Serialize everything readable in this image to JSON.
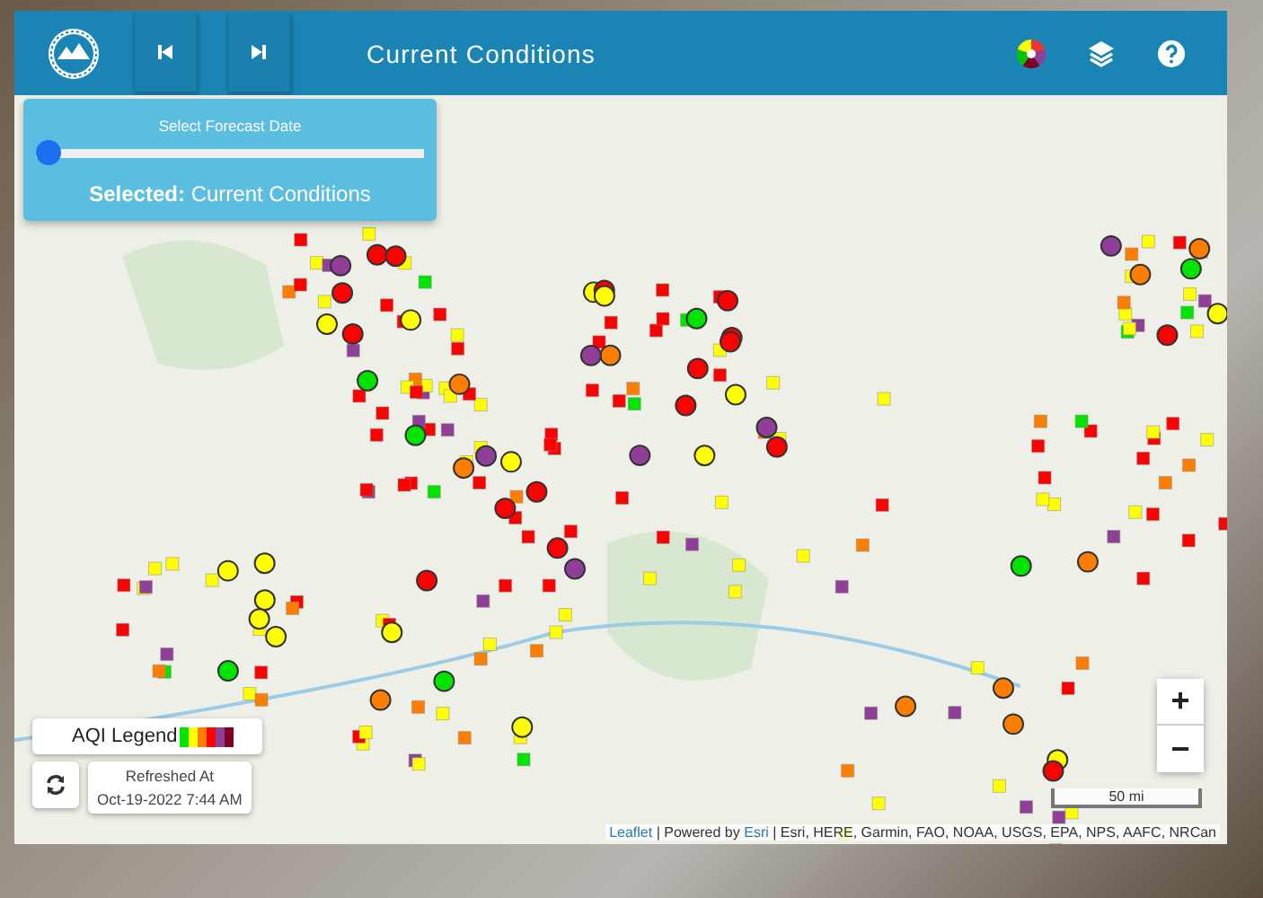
{
  "header": {
    "title": "Current Conditions"
  },
  "forecast_panel": {
    "title": "Select Forecast Date",
    "level": 0,
    "selected_label": "Selected:",
    "selected_value": "Current Conditions"
  },
  "legend": {
    "title": "AQI Legend",
    "swatches": [
      {
        "color": "#00e400"
      },
      {
        "color": "#ffff00"
      },
      {
        "color": "#ff7e00"
      },
      {
        "color": "#ff0000"
      },
      {
        "color": "#8f3f97"
      },
      {
        "color": "#7e0023"
      }
    ]
  },
  "refresh": {
    "label": "Refreshed At",
    "time": "Oct-19-2022 7:44 AM"
  },
  "zoom": {
    "in": "+",
    "out": "−"
  },
  "scale": "50 mi",
  "attribution": {
    "leaflet_link": "Leaflet",
    "powered_by": " | Powered by ",
    "esri_link": "Esri",
    "sources": " | Esri, HERE, Garmin, FAO, NOAA, USGS, EPA, NPS, AAFC, NRCan"
  }
}
